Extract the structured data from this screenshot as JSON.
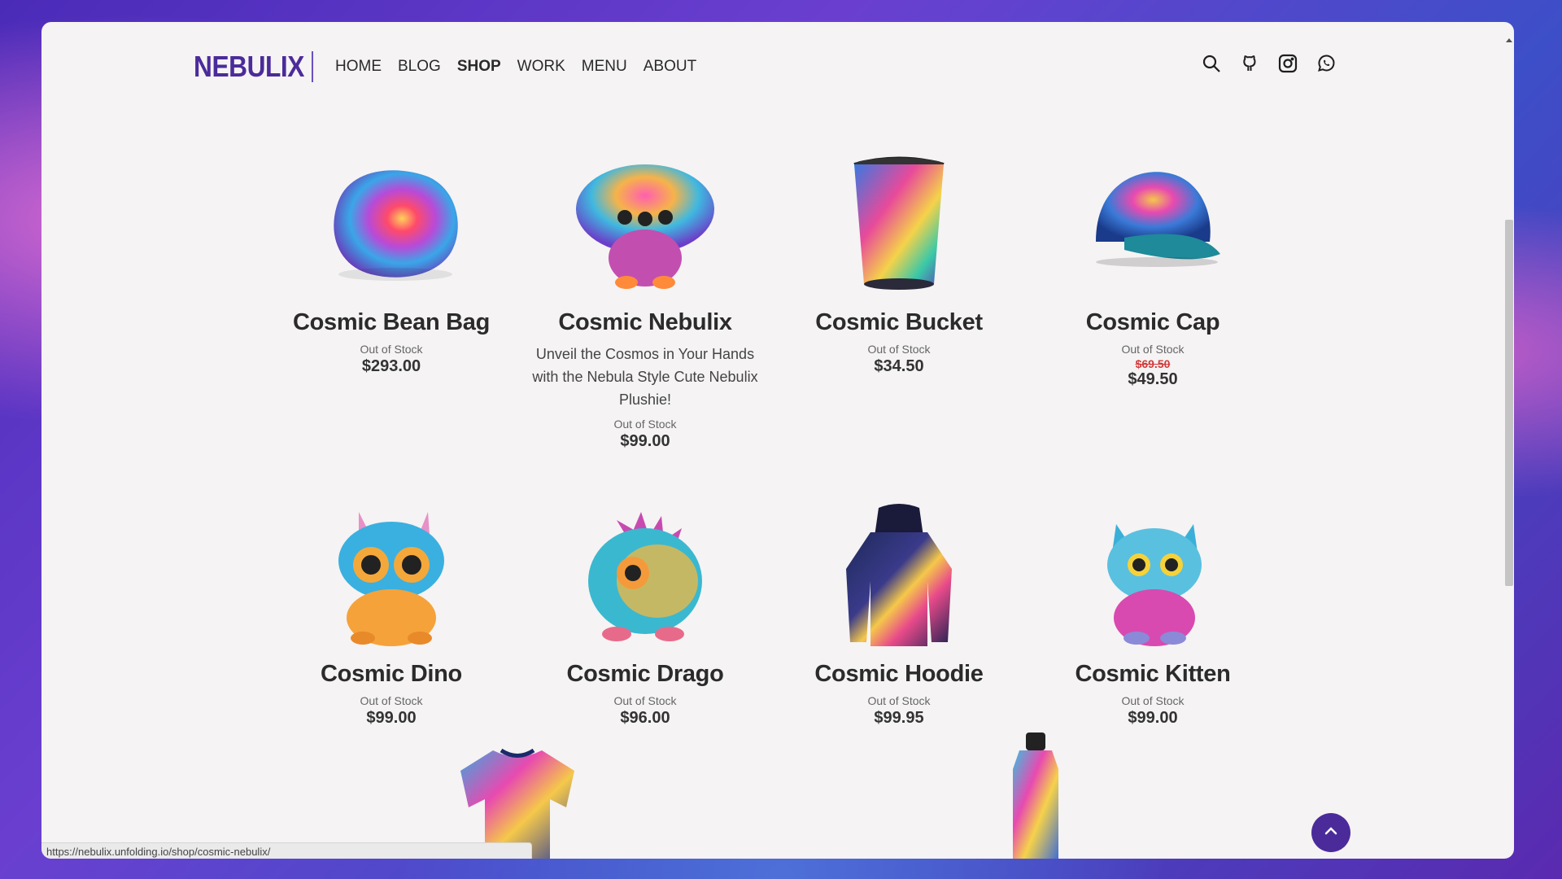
{
  "brand": {
    "logo": "NEBULIX",
    "accent": "#4b2b9a"
  },
  "nav": {
    "items": [
      {
        "label": "HOME",
        "active": false
      },
      {
        "label": "BLOG",
        "active": false
      },
      {
        "label": "SHOP",
        "active": true
      },
      {
        "label": "WORK",
        "active": false
      },
      {
        "label": "MENU",
        "active": false
      },
      {
        "label": "ABOUT",
        "active": false
      }
    ]
  },
  "header_icons": [
    "search-icon",
    "github-icon",
    "instagram-icon",
    "whatsapp-icon"
  ],
  "products": [
    {
      "name": "Cosmic Bean Bag",
      "stock": "Out of Stock",
      "price": "$293.00",
      "image": "bean-bag"
    },
    {
      "name": "Cosmic Nebulix",
      "desc": "Unveil the Cosmos in Your Hands with the Nebula Style Cute Nebulix Plushie!",
      "stock": "Out of Stock",
      "price": "$99.00",
      "image": "plush-nebulix"
    },
    {
      "name": "Cosmic Bucket",
      "stock": "Out of Stock",
      "price": "$34.50",
      "image": "bucket"
    },
    {
      "name": "Cosmic Cap",
      "stock": "Out of Stock",
      "old_price": "$69.50",
      "price": "$49.50",
      "image": "cap"
    },
    {
      "name": "Cosmic Dino",
      "stock": "Out of Stock",
      "price": "$99.00",
      "image": "plush-dino"
    },
    {
      "name": "Cosmic Drago",
      "stock": "Out of Stock",
      "price": "$96.00",
      "image": "plush-drago"
    },
    {
      "name": "Cosmic Hoodie",
      "stock": "Out of Stock",
      "price": "$99.95",
      "image": "hoodie"
    },
    {
      "name": "Cosmic Kitten",
      "stock": "Out of Stock",
      "price": "$99.00",
      "image": "plush-kitten"
    }
  ],
  "partial_products": [
    "t-shirt",
    "bottle"
  ],
  "status_bar": {
    "url": "https://nebulix.unfolding.io/shop/cosmic-nebulix/"
  }
}
